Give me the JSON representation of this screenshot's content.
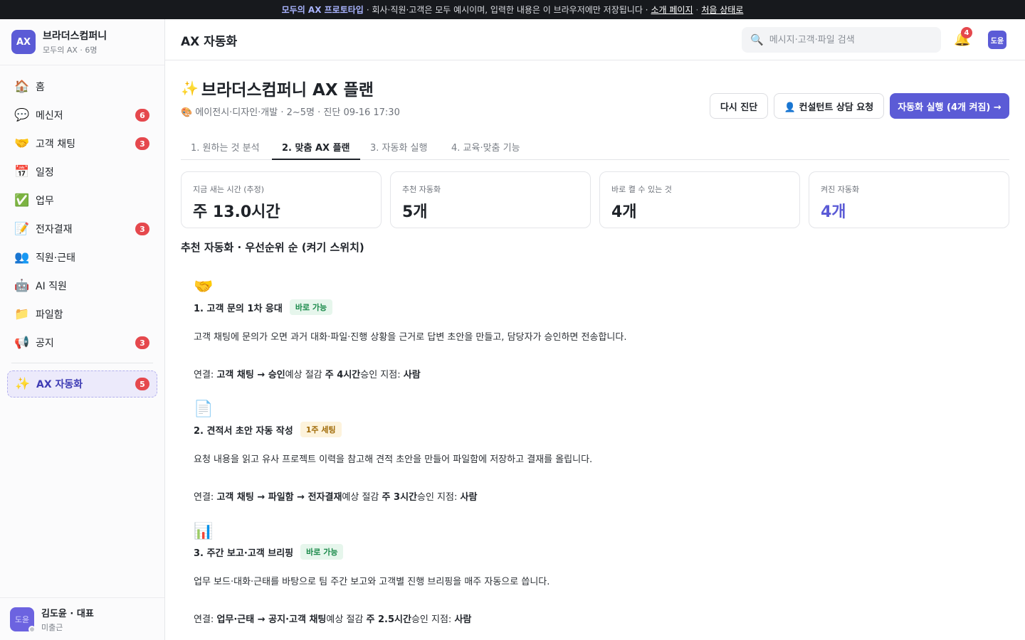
{
  "banner": {
    "highlight": "모두의 AX 프로토타입",
    "text": "· 회사·직원·고객은 모두 예시이며, 입력한 내용은 이 브라우저에만 저장됩니다 ·",
    "link_intro": "소개 페이지",
    "sep": "·",
    "link_reset": "처음 상태로"
  },
  "org": {
    "logo": "AX",
    "name": "브라더스컴퍼니",
    "sub": "모두의 AX · 6명"
  },
  "sidebar": {
    "items": [
      {
        "icon": "🏠",
        "icon_name": "home-icon",
        "label": "홈",
        "badge": null
      },
      {
        "icon": "💬",
        "icon_name": "chat-icon",
        "label": "메신저",
        "badge": "6"
      },
      {
        "icon": "🤝",
        "icon_name": "handshake-icon",
        "label": "고객 채팅",
        "badge": "3"
      },
      {
        "icon": "📅",
        "icon_name": "calendar-icon",
        "label": "일정",
        "badge": null
      },
      {
        "icon": "✅",
        "icon_name": "check-icon",
        "label": "업무",
        "badge": null
      },
      {
        "icon": "📝",
        "icon_name": "memo-icon",
        "label": "전자결재",
        "badge": "3"
      },
      {
        "icon": "👥",
        "icon_name": "people-icon",
        "label": "직원·근태",
        "badge": null
      },
      {
        "icon": "🤖",
        "icon_name": "robot-icon",
        "label": "AI 직원",
        "badge": null
      },
      {
        "icon": "📁",
        "icon_name": "folder-icon",
        "label": "파일함",
        "badge": null
      },
      {
        "icon": "📢",
        "icon_name": "megaphone-icon",
        "label": "공지",
        "badge": "3"
      }
    ],
    "active": {
      "icon": "✨",
      "label": "AX 자동화",
      "badge": "5"
    }
  },
  "user": {
    "avatar": "도윤",
    "name": "김도윤 · 대표",
    "status": "미출근"
  },
  "topbar": {
    "title": "AX 자동화",
    "search_placeholder": "메시지·고객·파일 검색",
    "bell_badge": "4",
    "avatar": "도윤"
  },
  "hero": {
    "icon": "✨",
    "title": "브라더스컴퍼니 AX 플랜",
    "meta": "🎨 에이전시·디자인·개발 · 2~5명 · 진단 09-16 17:30",
    "btn_rediagnose": "다시 진단",
    "btn_consult": "👤 컨설턴트 상담 요청",
    "btn_run": "자동화 실행 (4개 켜짐) →"
  },
  "tabs": [
    "1. 원하는 것 분석",
    "2. 맞춤 AX 플랜",
    "3. 자동화 실행",
    "4. 교육·맞춤 기능"
  ],
  "active_tab": 1,
  "stats": [
    {
      "label": "지금 새는 시간 (추정)",
      "value": "주 13.0시간",
      "accent": false
    },
    {
      "label": "추천 자동화",
      "value": "5개",
      "accent": false
    },
    {
      "label": "바로 켤 수 있는 것",
      "value": "4개",
      "accent": false
    },
    {
      "label": "켜진 자동화",
      "value": "4개",
      "accent": true
    }
  ],
  "accent_color": "#5b5bd6",
  "section_title": "추천 자동화 · 우선순위 순 (켜기 스위치)",
  "recommendations": [
    {
      "icon": "🤝",
      "title": "1. 고객 문의 1차 응대",
      "tag": "바로 가능",
      "tag_color": "green",
      "desc": "고객 채팅에 문의가 오면 과거 대화·파일·진행 상황을 근거로 답변 초안을 만들고, 담당자가 승인하면 전송합니다.",
      "link_prefix": "연결: ",
      "link_path": "고객 채팅 → 승인",
      "save_prefix": "예상 절감 ",
      "save_value": "주 4시간",
      "approve_prefix": "승인 지점: ",
      "approve_value": "사람"
    },
    {
      "icon": "📄",
      "title": "2. 견적서 초안 자동 작성",
      "tag": "1주 세팅",
      "tag_color": "amber",
      "desc": "요청 내용을 읽고 유사 프로젝트 이력을 참고해 견적 초안을 만들어 파일함에 저장하고 결재를 올립니다.",
      "link_prefix": "연결: ",
      "link_path": "고객 채팅 → 파일함 → 전자결재",
      "save_prefix": "예상 절감 ",
      "save_value": "주 3시간",
      "approve_prefix": "승인 지점: ",
      "approve_value": "사람"
    },
    {
      "icon": "📊",
      "title": "3. 주간 보고·고객 브리핑",
      "tag": "바로 가능",
      "tag_color": "green",
      "desc": "업무 보드·대화·근태를 바탕으로 팀 주간 보고와 고객별 진행 브리핑을 매주 자동으로 씁니다.",
      "link_prefix": "연결: ",
      "link_path": "업무·근태 → 공지·고객 채팅",
      "save_prefix": "예상 절감 ",
      "save_value": "주 2.5시간",
      "approve_prefix": "승인 지점: ",
      "approve_value": "사람"
    }
  ]
}
